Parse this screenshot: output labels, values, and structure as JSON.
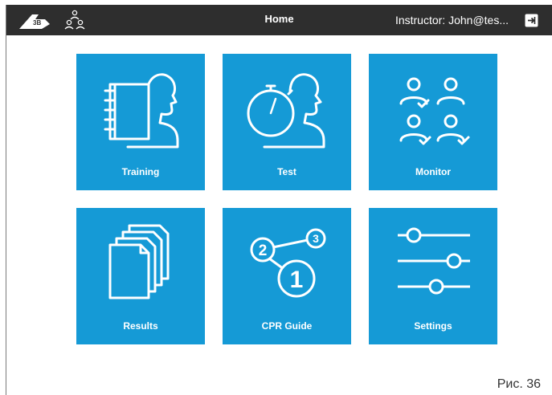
{
  "header": {
    "title": "Home",
    "instructor": "Instructor: John@tes...",
    "logo_icon": "3b-logo-icon",
    "users_icon": "users-icon",
    "logout_icon": "logout-icon",
    "background": "#2e2e2e"
  },
  "tiles": [
    {
      "label": "Training",
      "icon": "training-icon"
    },
    {
      "label": "Test",
      "icon": "test-stopwatch-icon"
    },
    {
      "label": "Monitor",
      "icon": "monitor-users-icon"
    },
    {
      "label": "Results",
      "icon": "results-documents-icon"
    },
    {
      "label": "CPR Guide",
      "icon": "cpr-guide-steps-icon"
    },
    {
      "label": "Settings",
      "icon": "settings-sliders-icon"
    }
  ],
  "tile_color": "#159ad6",
  "caption": "Рис. 36"
}
